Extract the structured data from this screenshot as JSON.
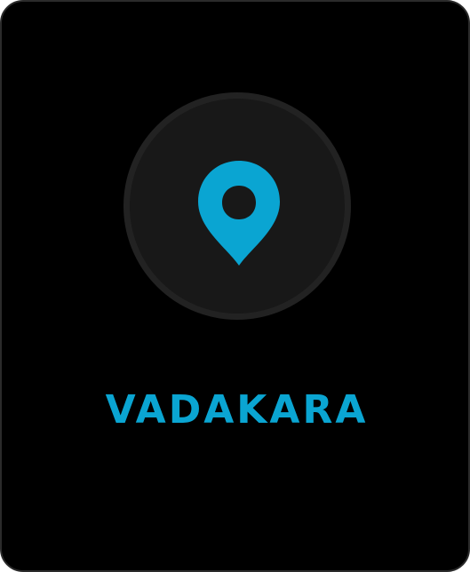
{
  "card": {
    "title": "VADAKARA",
    "icon": "location-pin-icon",
    "accent_color": "#0aa5d2",
    "background_color": "#000000"
  }
}
